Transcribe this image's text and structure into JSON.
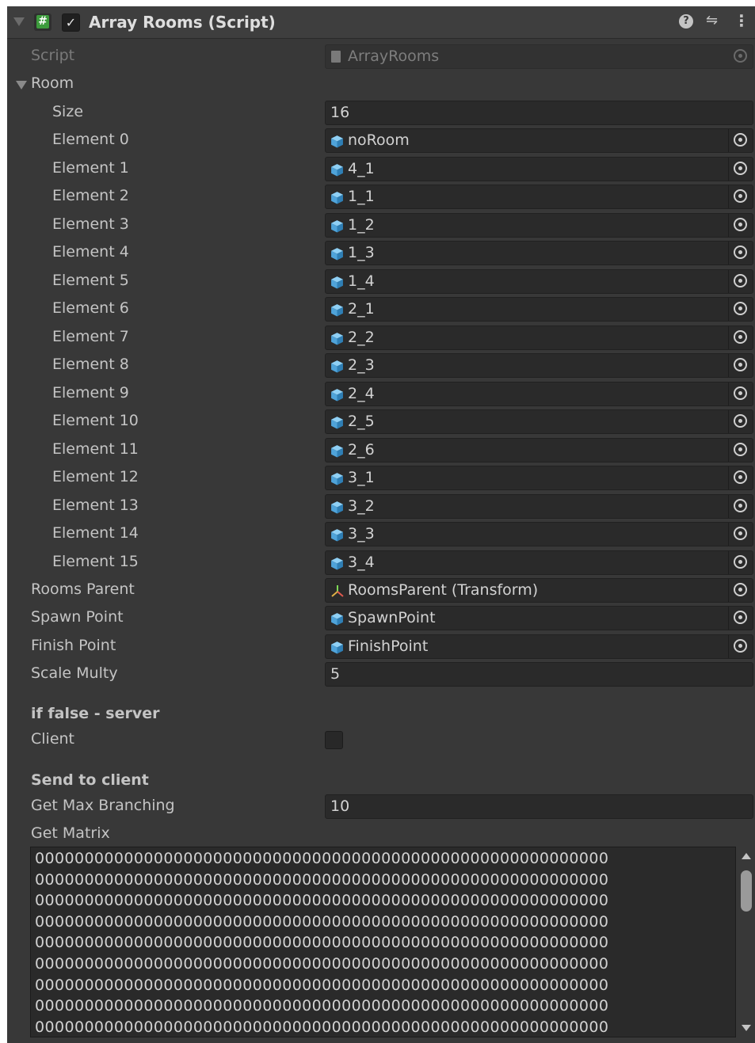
{
  "component": {
    "title": "Array Rooms (Script)",
    "enabled": true,
    "icons": {
      "fold": "collapse-arrow-icon",
      "script": "csharp-script-icon",
      "help": "help-icon",
      "preset": "preset-sliders-icon",
      "menu": "kebab-menu-icon"
    }
  },
  "script": {
    "label": "Script",
    "value": "ArrayRooms"
  },
  "room": {
    "label": "Room",
    "size_label": "Size",
    "size": "16",
    "elements": [
      {
        "label": "Element 0",
        "value": "noRoom"
      },
      {
        "label": "Element 1",
        "value": "4_1"
      },
      {
        "label": "Element 2",
        "value": "1_1"
      },
      {
        "label": "Element 3",
        "value": "1_2"
      },
      {
        "label": "Element 4",
        "value": "1_3"
      },
      {
        "label": "Element 5",
        "value": "1_4"
      },
      {
        "label": "Element 6",
        "value": "2_1"
      },
      {
        "label": "Element 7",
        "value": "2_2"
      },
      {
        "label": "Element 8",
        "value": "2_3"
      },
      {
        "label": "Element 9",
        "value": "2_4"
      },
      {
        "label": "Element 10",
        "value": "2_5"
      },
      {
        "label": "Element 11",
        "value": "2_6"
      },
      {
        "label": "Element 12",
        "value": "3_1"
      },
      {
        "label": "Element 13",
        "value": "3_2"
      },
      {
        "label": "Element 14",
        "value": "3_3"
      },
      {
        "label": "Element 15",
        "value": "3_4"
      }
    ]
  },
  "rooms_parent": {
    "label": "Rooms Parent",
    "value": "RoomsParent (Transform)"
  },
  "spawn_point": {
    "label": "Spawn Point",
    "value": "SpawnPoint"
  },
  "finish_point": {
    "label": "Finish Point",
    "value": "FinishPoint"
  },
  "scale_multy": {
    "label": "Scale Multy",
    "value": "5"
  },
  "server_header": "if false - server",
  "client": {
    "label": "Client",
    "checked": false
  },
  "send_header": "Send to client",
  "max_branching": {
    "label": "Get Max Branching",
    "value": "10"
  },
  "matrix": {
    "label": "Get Matrix",
    "lines": [
      "0000000000000000000000000000000000000000000000000000000000",
      "0000000000000000000000000000000000000000000000000000000000",
      "0000000000000000000000000000000000000000000000000000000000",
      "0000000000000000000000000000000000000000000000000000000000",
      "0000000000000000000000000000000000000000000000000000000000",
      "0000000000000000000000000000000000000000000000000000000000",
      "0000000000000000000000000000000000000000000000000000000000",
      "0000000000000000000000000000000000000000000000000000000000",
      "0000000000000000000000000000000000000000000000000000000000"
    ]
  },
  "colors": {
    "panel": "#383838",
    "field": "#2a2a2a",
    "text": "#c4c4c4",
    "cube": "#4fa3d9",
    "script_green": "#3d9b3d"
  }
}
